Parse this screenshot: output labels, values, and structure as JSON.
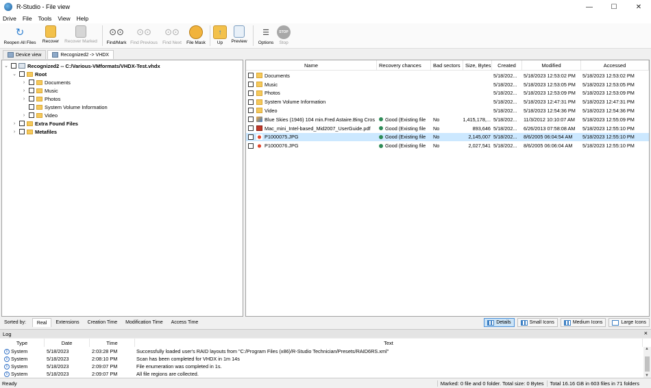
{
  "window": {
    "title": "R-Studio - File view",
    "minimize": "—",
    "maximize": "☐",
    "close": "✕"
  },
  "menu": [
    "Drive",
    "File",
    "Tools",
    "View",
    "Help"
  ],
  "toolbar": [
    {
      "label": "Reopen All Files",
      "icon": "reopen-icon",
      "disabled": false
    },
    {
      "label": "Recover",
      "icon": "recover-icon",
      "disabled": false
    },
    {
      "label": "Recover Marked",
      "icon": "recover-marked-icon",
      "disabled": true
    },
    {
      "label": "Find/Mark",
      "icon": "binoculars-icon",
      "disabled": false
    },
    {
      "label": "Find Previous",
      "icon": "find-previous-icon",
      "disabled": true
    },
    {
      "label": "Find Next",
      "icon": "find-next-icon",
      "disabled": true
    },
    {
      "label": "File Mask",
      "icon": "file-mask-icon",
      "disabled": false
    },
    {
      "label": "Up",
      "icon": "up-folder-icon",
      "disabled": false
    },
    {
      "label": "Preview",
      "icon": "preview-icon",
      "disabled": false
    },
    {
      "label": "Options",
      "icon": "options-icon",
      "disabled": false
    },
    {
      "label": "Stop",
      "icon": "stop-icon",
      "disabled": true
    }
  ],
  "tabs": [
    "Device view",
    "Recognized2 -> VHDX"
  ],
  "tree": {
    "root_label": "Recognized2 -- C:/Various-VMformats/VHDX-Test.vhdx",
    "root_folder": "Root",
    "children": [
      "Documents",
      "Music",
      "Photos",
      "System Volume Information",
      "Video"
    ],
    "extra": "Extra Found Files",
    "meta": "Metafiles"
  },
  "list": {
    "columns": [
      "Name",
      "Recovery chances",
      "Bad sectors",
      "Size, Bytes",
      "Created",
      "Modified",
      "Accessed"
    ],
    "rows": [
      {
        "name": "Documents",
        "type": "folder",
        "chance": "",
        "bad": "",
        "size": "",
        "created": "5/18/202...",
        "modified": "5/18/2023 12:53:02 PM",
        "accessed": "5/18/2023 12:53:02 PM"
      },
      {
        "name": "Music",
        "type": "folder",
        "chance": "",
        "bad": "",
        "size": "",
        "created": "5/18/202...",
        "modified": "5/18/2023 12:53:05 PM",
        "accessed": "5/18/2023 12:53:05 PM"
      },
      {
        "name": "Photos",
        "type": "folder",
        "chance": "",
        "bad": "",
        "size": "",
        "created": "5/18/202...",
        "modified": "5/18/2023 12:53:09 PM",
        "accessed": "5/18/2023 12:53:09 PM"
      },
      {
        "name": "System Volume Information",
        "type": "folder",
        "chance": "",
        "bad": "",
        "size": "",
        "created": "5/18/202...",
        "modified": "5/18/2023 12:47:31 PM",
        "accessed": "5/18/2023 12:47:31 PM"
      },
      {
        "name": "Video",
        "type": "folder",
        "chance": "",
        "bad": "",
        "size": "",
        "created": "5/18/202...",
        "modified": "5/18/2023 12:54:36 PM",
        "accessed": "5/18/2023 12:54:36 PM"
      },
      {
        "name": "Blue Skies (1946) 104 min.Fred Astaire.Bing Cros",
        "type": "video",
        "chance": "Good (Existing file",
        "bad": "No",
        "size": "1,415,178,...",
        "created": "5/18/202...",
        "modified": "11/3/2012 10:10:07 AM",
        "accessed": "5/18/2023 12:55:09 PM"
      },
      {
        "name": "Mac_mini_Intel-based_Mid2007_UserGuide.pdf",
        "type": "pdf",
        "chance": "Good (Existing file",
        "bad": "No",
        "size": "893,646",
        "created": "5/18/202...",
        "modified": "6/26/2013 07:58:08 AM",
        "accessed": "5/18/2023 12:55:10 PM"
      },
      {
        "name": "P1000075.JPG",
        "type": "image",
        "chance": "Good (Existing file",
        "bad": "No",
        "size": "2,145,007",
        "created": "5/18/202...",
        "modified": "8/6/2005 06:04:54 AM",
        "accessed": "5/18/2023 12:55:10 PM",
        "selected": true
      },
      {
        "name": "P1000076.JPG",
        "type": "image",
        "chance": "Good (Existing file",
        "bad": "No",
        "size": "2,027,541",
        "created": "5/18/202...",
        "modified": "8/6/2005 06:06:04 AM",
        "accessed": "5/18/2023 12:55:10 PM"
      }
    ]
  },
  "sortbar": {
    "label": "Sorted by:",
    "tabs": [
      "Real",
      "Extensions",
      "Creation Time",
      "Modification Time",
      "Access Time"
    ],
    "views": [
      "Details",
      "Small Icons",
      "Medium Icons",
      "Large Icons"
    ]
  },
  "log": {
    "title": "Log",
    "close": "×",
    "columns": [
      "Type",
      "Date",
      "Time",
      "Text"
    ],
    "rows": [
      {
        "type": "System",
        "date": "5/18/2023",
        "time": "2:03:28 PM",
        "text": "Successfully loaded user's RAID layouts from \"C:/Program Files (x86)/R-Studio Technician/Presets/RAID6RS.xml\""
      },
      {
        "type": "System",
        "date": "5/18/2023",
        "time": "2:08:10 PM",
        "text": "Scan has been completed for VHDX in 1m 14s"
      },
      {
        "type": "System",
        "date": "5/18/2023",
        "time": "2:09:07 PM",
        "text": "File enumeration was completed in 1s."
      },
      {
        "type": "System",
        "date": "5/18/2023",
        "time": "2:09:07 PM",
        "text": "All file regions are collected."
      }
    ]
  },
  "status": {
    "left": "Ready",
    "marked": "Marked: 0 file and 0 folder. Total size: 0 Bytes",
    "total": "Total 16.16 GB in 603 files in 71 folders"
  },
  "colors": {
    "good_dot": "#2e8b57",
    "selection": "#cce8ff",
    "folder": "#f5c95c"
  }
}
